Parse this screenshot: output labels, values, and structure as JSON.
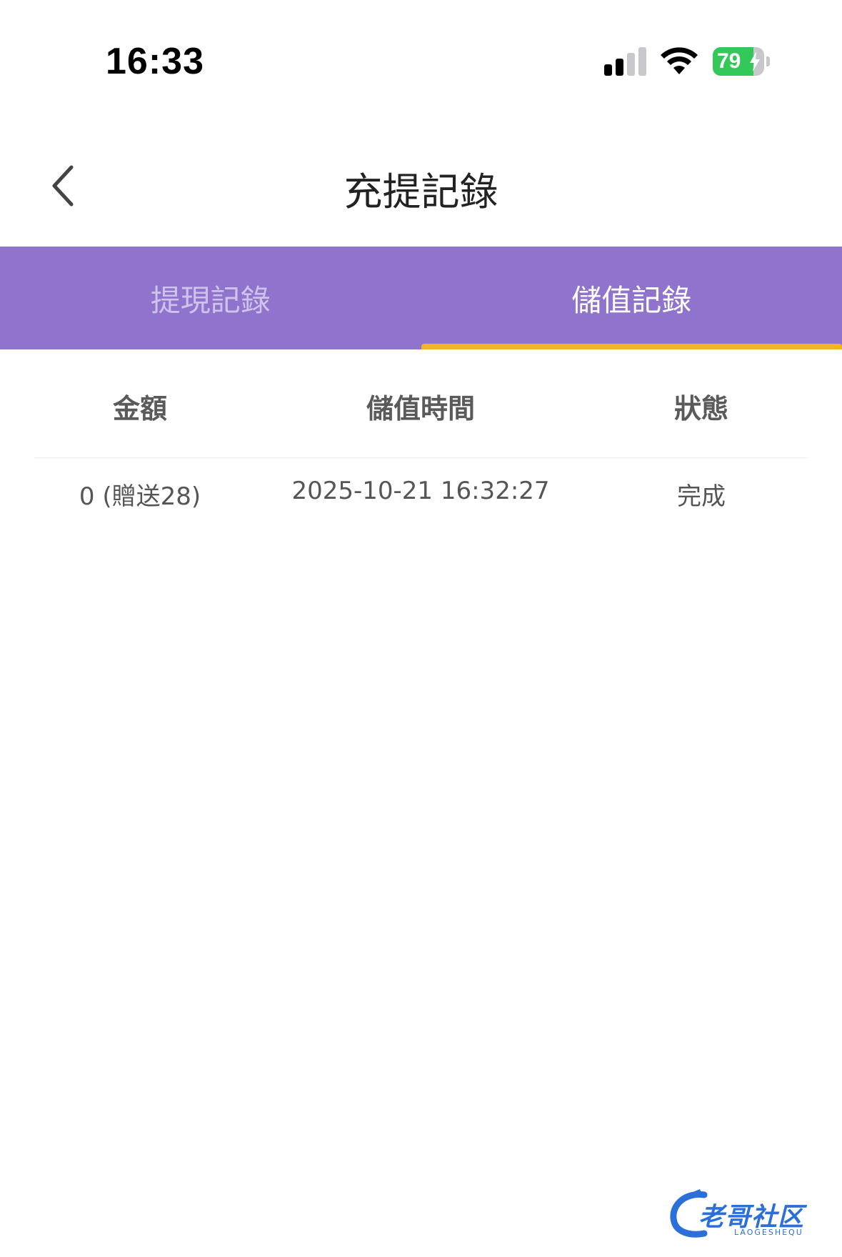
{
  "status_bar": {
    "time": "16:33",
    "battery_level": "79",
    "battery_fraction": 0.79,
    "signal_icon": "cellular-signal-icon",
    "wifi_icon": "wifi-icon",
    "charging_icon": "bolt-icon"
  },
  "nav": {
    "title": "充提記錄",
    "back_icon": "chevron-left-icon"
  },
  "tabs": [
    {
      "label": "提現記錄",
      "active": false
    },
    {
      "label": "儲值記錄",
      "active": true
    }
  ],
  "table": {
    "headers": [
      "金額",
      "儲值時間",
      "狀態"
    ],
    "rows": [
      [
        "0 (贈送28)",
        "2025-10-21 16:32:27",
        "完成"
      ]
    ]
  },
  "watermark": {
    "text": "老哥社区",
    "sub": "LAOGESHEQU"
  },
  "colors": {
    "tab_bar": "#8f73cd",
    "tab_underline": "#f0b429",
    "battery_green": "#34c759",
    "watermark_blue": "#2b6fd9"
  }
}
